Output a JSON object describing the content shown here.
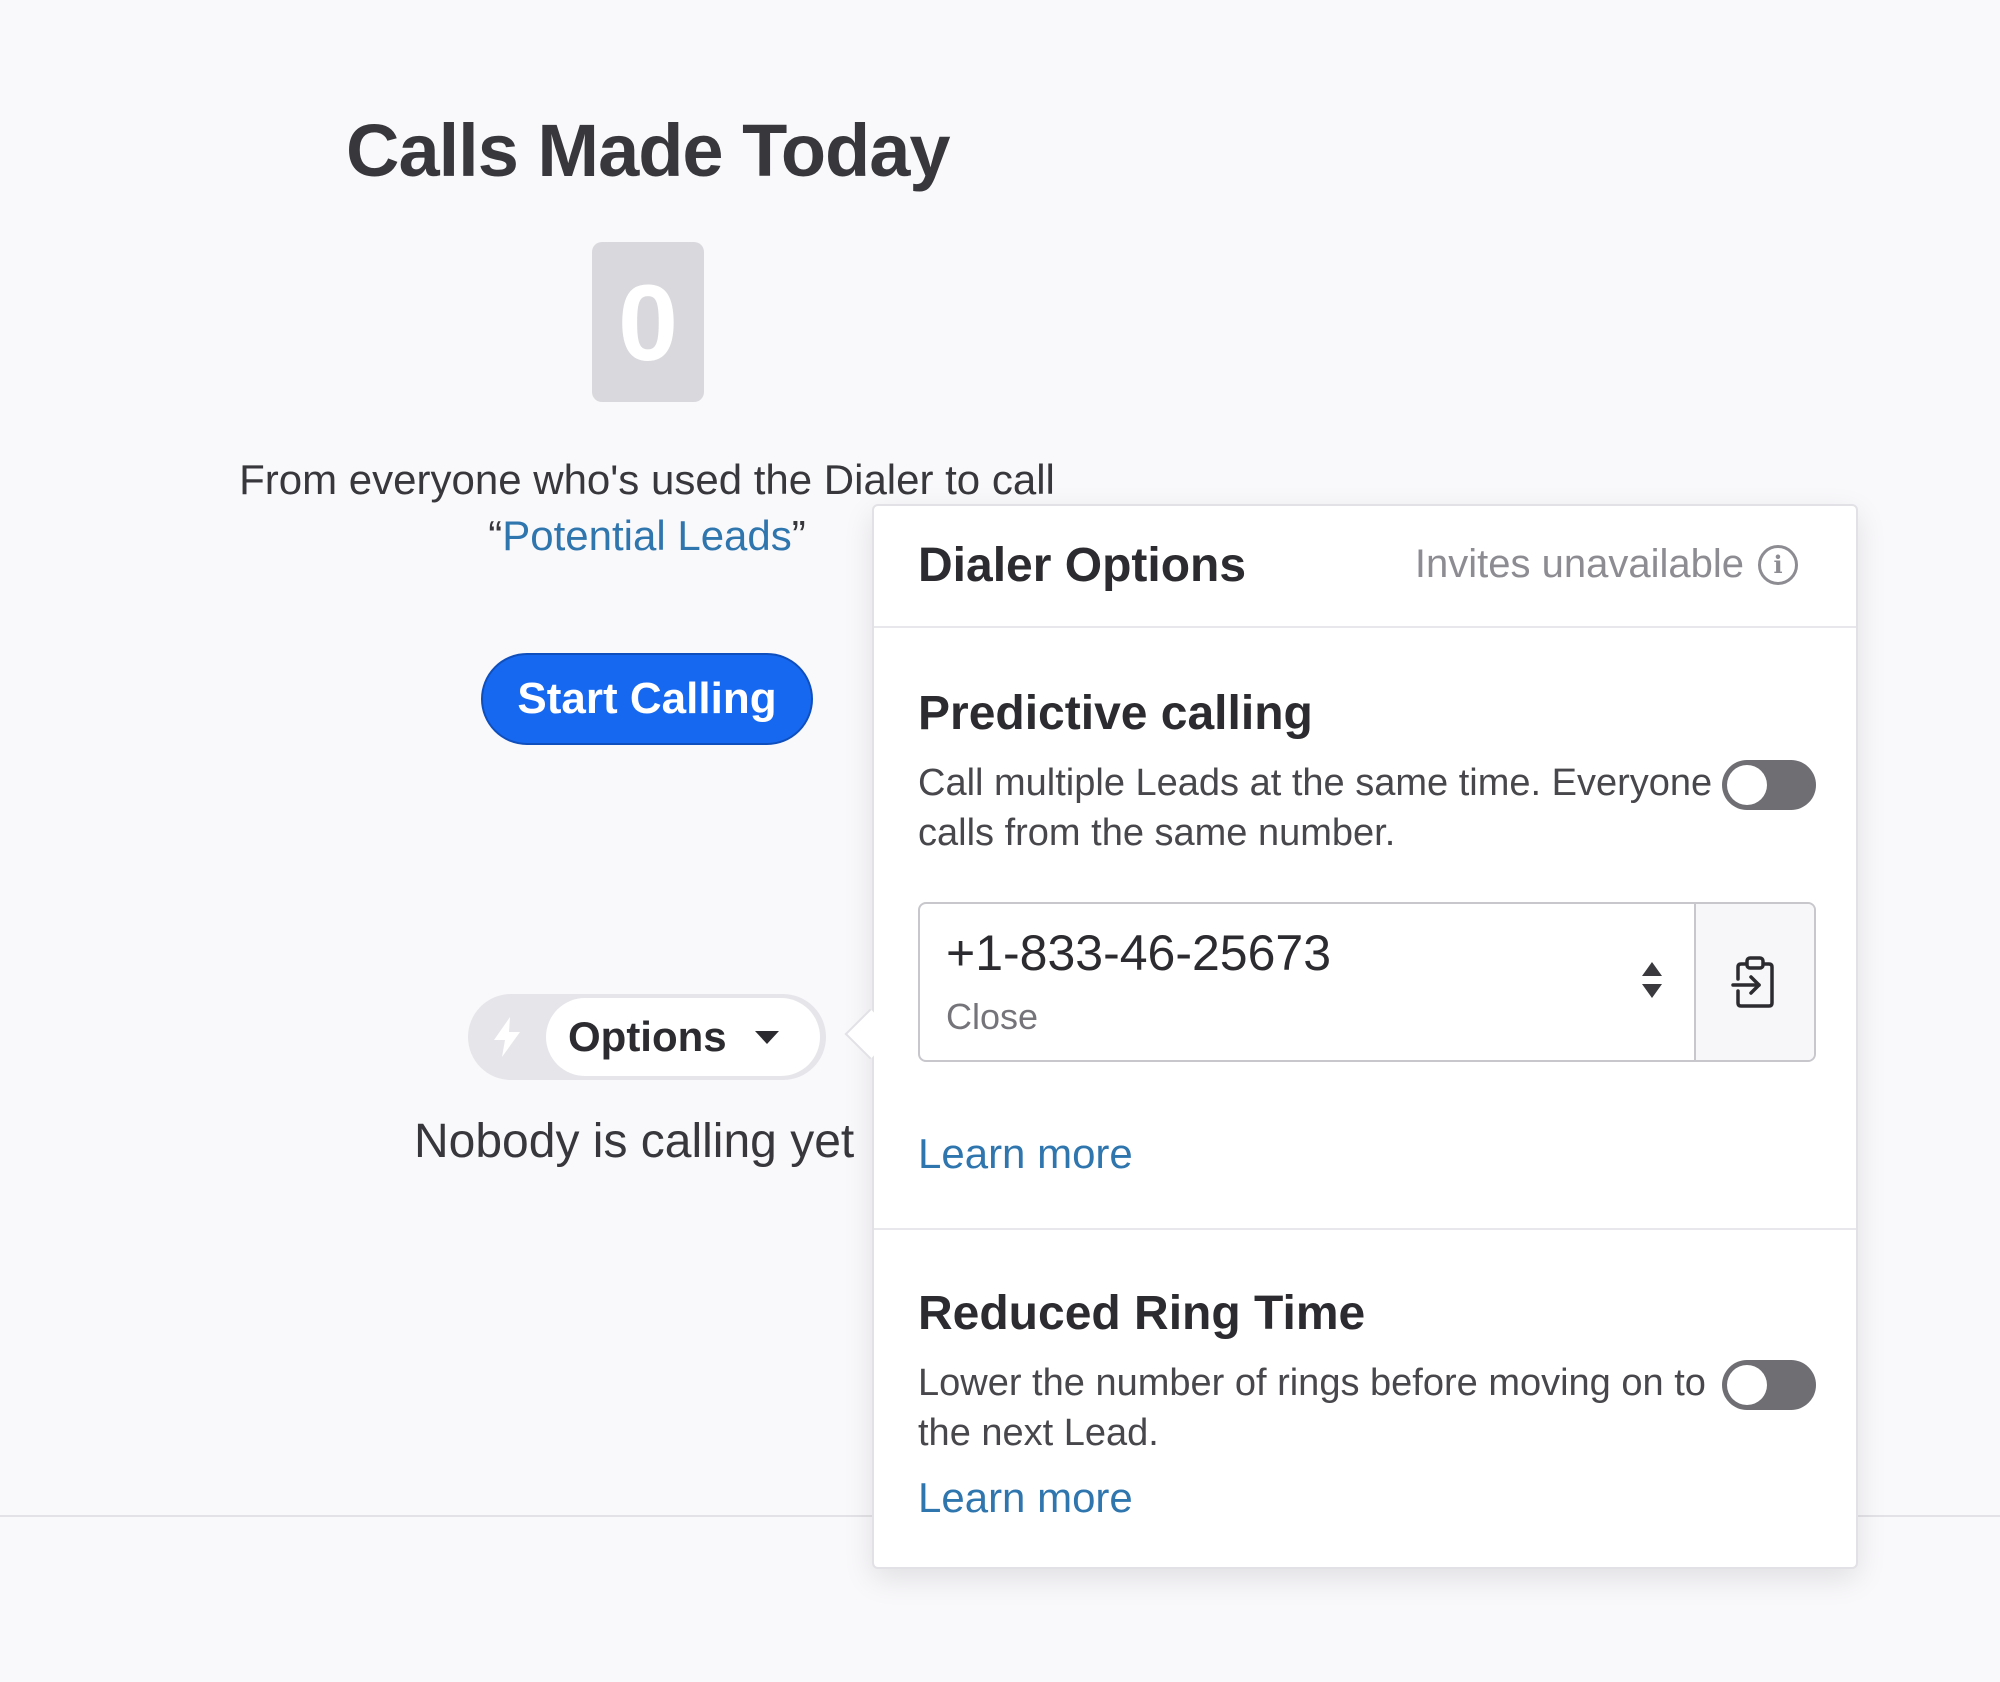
{
  "main": {
    "title": "Calls Made Today",
    "count": "0",
    "subtitle_line1": "From everyone who's used the Dialer to call",
    "quote_open": "“",
    "list_name": "Potential Leads",
    "quote_close": "”",
    "start_button": "Start Calling",
    "options_button": "Options",
    "status_text": "Nobody is calling yet"
  },
  "dialer_options": {
    "title": "Dialer Options",
    "invites_status": "Invites unavailable",
    "predictive": {
      "heading": "Predictive calling",
      "description": "Call multiple Leads at the same time. Everyone calls from the same number.",
      "enabled": false,
      "phone_number": "+1-833-46-25673",
      "phone_label": "Close",
      "learn_more": "Learn more"
    },
    "reduced_ring": {
      "heading": "Reduced Ring Time",
      "description": "Lower the number of rings before moving on to the next Lead.",
      "enabled": false,
      "learn_more": "Learn more"
    }
  },
  "colors": {
    "primary_button": "#1768f0",
    "link": "#2f75ae",
    "toggle_off": "#6f6e73",
    "background": "#f9f8fb"
  },
  "icons": [
    "bolt-icon",
    "caret-down-icon",
    "info-icon",
    "stepper-icon",
    "paste-into-icon"
  ]
}
